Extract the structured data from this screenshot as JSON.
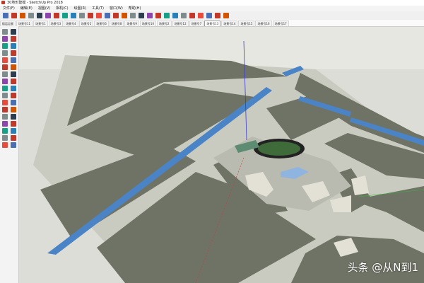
{
  "window": {
    "title": "30地形建模 - SketchUp Pro 2018"
  },
  "menu": [
    "文件(F)",
    "编辑(E)",
    "视图(V)",
    "相机(C)",
    "绘图(R)",
    "工具(T)",
    "窗口(W)",
    "帮助(H)"
  ],
  "scenes": [
    "楼层定额",
    "场景号11",
    "场景号1",
    "场景号3",
    "场景号4",
    "场景号5",
    "场景号6",
    "场景号8",
    "场景号9",
    "场景号10",
    "场景号2",
    "场景号12",
    "场景号7",
    "场景号13",
    "场景号14",
    "场景号15",
    "场景号16",
    "场景号17"
  ],
  "active_scene": "场景号13",
  "toolbar_icons": [
    "select-icon",
    "eraser-icon",
    "pencil-icon",
    "arc-icon",
    "rectangle-icon",
    "push-pull-icon",
    "move-icon",
    "rotate-icon",
    "offset-icon",
    "tape-icon",
    "paint-icon",
    "orbit-icon",
    "pan-icon",
    "zoom-icon",
    "zoom-extents-icon",
    "iso-view-icon",
    "top-view-icon",
    "front-view-icon",
    "right-view-icon",
    "back-view-icon",
    "left-view-icon",
    "xray-icon",
    "wireframe-icon",
    "hidden-line-icon",
    "shaded-icon",
    "textured-icon",
    "monochrome-icon"
  ],
  "left_tool_icons": [
    "select-icon",
    "make-component-icon",
    "eraser-icon",
    "paint-bucket-icon",
    "line-icon",
    "freehand-icon",
    "rectangle-icon",
    "rotated-rectangle-icon",
    "circle-icon",
    "polygon-icon",
    "arc-icon",
    "pie-icon",
    "move-icon",
    "push-pull-icon",
    "rotate-icon",
    "follow-me-icon",
    "scale-icon",
    "offset-icon",
    "tape-measure-icon",
    "dimension-icon",
    "protractor-icon",
    "text-icon",
    "axes-icon",
    "3d-text-icon",
    "orbit-icon",
    "pan-icon",
    "zoom-icon",
    "zoom-window-icon",
    "zoom-extents-icon",
    "previous-view-icon",
    "position-camera-icon",
    "walk-icon",
    "look-around-icon",
    "section-plane-icon"
  ],
  "watermark": "头条 @从N到1",
  "colors": {
    "grass": "#6f7365",
    "road": "#c9cbc1",
    "water": "#4a84c7",
    "track": "#3f6a3a",
    "ground": "#dcddd6"
  }
}
